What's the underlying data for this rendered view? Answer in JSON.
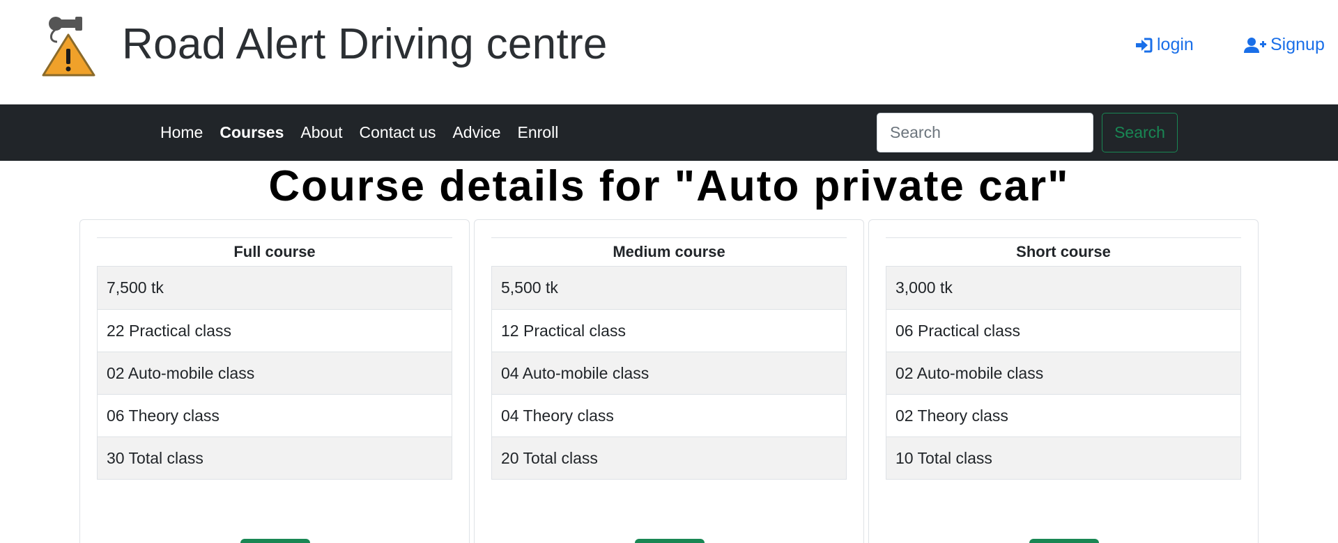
{
  "header": {
    "site_title": "Road Alert Driving centre",
    "logo_icon": "warning-key-logo-icon",
    "login_label": "login",
    "signup_label": "Signup",
    "accent_color": "#1a6fe8"
  },
  "navbar": {
    "items": [
      {
        "label": "Home",
        "active": false
      },
      {
        "label": "Courses",
        "active": true
      },
      {
        "label": "About",
        "active": false
      },
      {
        "label": "Contact us",
        "active": false
      },
      {
        "label": "Advice",
        "active": false
      },
      {
        "label": "Enroll",
        "active": false
      }
    ],
    "search_placeholder": "Search",
    "search_button_label": "Search",
    "background_color": "#212529",
    "search_button_color": "#198754"
  },
  "main": {
    "page_title": "Course details for \"Auto private car\"",
    "courses": [
      {
        "name": "Full course",
        "features": [
          "7,500 tk",
          "22 Practical class",
          "02 Auto-mobile class",
          "06 Theory class",
          "30 Total class"
        ]
      },
      {
        "name": "Medium course",
        "features": [
          "5,500 tk",
          "12 Practical class",
          "04 Auto-mobile class",
          "04 Theory class",
          "20 Total class"
        ]
      },
      {
        "name": "Short course",
        "features": [
          "3,000 tk",
          "06 Practical class",
          "02 Auto-mobile class",
          "02 Theory class",
          "10 Total class"
        ]
      }
    ]
  }
}
